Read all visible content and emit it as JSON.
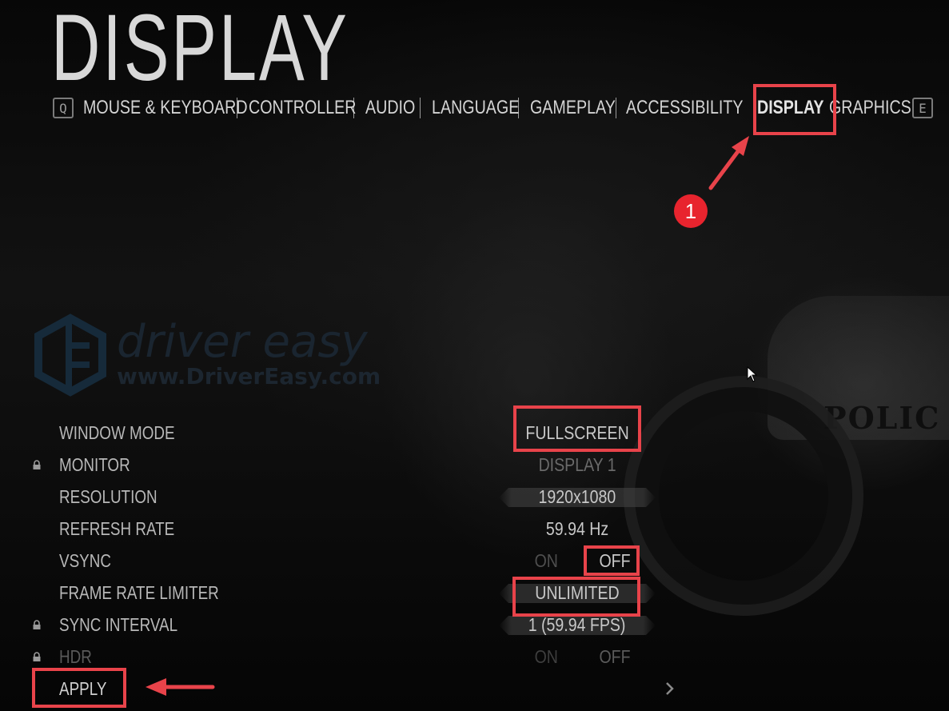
{
  "page": {
    "title": "DISPLAY"
  },
  "nav": {
    "prev_key": "Q",
    "next_key": "E",
    "items": [
      {
        "label": "MOUSE & KEYBOARD"
      },
      {
        "label": "CONTROLLER"
      },
      {
        "label": "AUDIO"
      },
      {
        "label": "LANGUAGE"
      },
      {
        "label": "GAMEPLAY"
      },
      {
        "label": "ACCESSIBILITY"
      },
      {
        "label": "DISPLAY",
        "active": true
      },
      {
        "label": "GRAPHICS"
      }
    ]
  },
  "watermark": {
    "brand": "driver easy",
    "url": "www.DriverEasy.com"
  },
  "background": {
    "car_text": "POLIC"
  },
  "settings": [
    {
      "label": "WINDOW MODE",
      "value": "FULLSCREEN",
      "locked": false,
      "type": "select"
    },
    {
      "label": "MONITOR",
      "value": "DISPLAY 1",
      "locked": true,
      "type": "text"
    },
    {
      "label": "RESOLUTION",
      "value": "1920x1080",
      "locked": false,
      "type": "slider"
    },
    {
      "label": "REFRESH RATE",
      "value": "59.94 Hz",
      "locked": false,
      "type": "text"
    },
    {
      "label": "VSYNC",
      "on_label": "ON",
      "off_label": "OFF",
      "value": "OFF",
      "locked": false,
      "type": "toggle"
    },
    {
      "label": "FRAME RATE LIMITER",
      "value": "UNLIMITED",
      "locked": false,
      "type": "slider"
    },
    {
      "label": "SYNC INTERVAL",
      "value": "1 (59.94 FPS)",
      "locked": true,
      "type": "slider"
    },
    {
      "label": "HDR",
      "on_label": "ON",
      "off_label": "OFF",
      "value": "OFF",
      "locked": true,
      "type": "toggle"
    }
  ],
  "apply": {
    "label": "APPLY"
  },
  "annotation": {
    "step_number": "1",
    "highlight_color": "#e8434a",
    "badge_color": "#e8242e"
  }
}
